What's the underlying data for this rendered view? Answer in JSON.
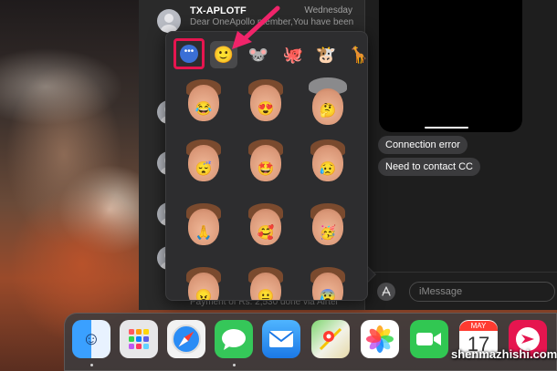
{
  "conversation_list": {
    "top_item": {
      "name": "TX-APLOTF",
      "date": "Wednesday",
      "preview": "Dear OneApollo member,You have been"
    },
    "bottom_preview": "Payment of Rs. 2,530 done via Airtel"
  },
  "chat": {
    "bubbles": [
      "Connection error",
      "Need to contact CC"
    ],
    "input_placeholder": "iMessage"
  },
  "sticker_popover": {
    "more_packs_label": "•••",
    "packs": [
      {
        "name": "memoji-pack",
        "glyph": "🙂"
      },
      {
        "name": "mouse-pack",
        "glyph": "🐭"
      },
      {
        "name": "octopus-pack",
        "glyph": "🐙"
      },
      {
        "name": "cow-pack",
        "glyph": "🐮"
      },
      {
        "name": "giraffe-pack",
        "glyph": "🦒"
      }
    ],
    "stickers": [
      {
        "name": "laughing-memoji",
        "face": "😂"
      },
      {
        "name": "heart-eyes-memoji",
        "face": "😍"
      },
      {
        "name": "thinking-hat-memoji",
        "face": "🤔"
      },
      {
        "name": "sleeping-memoji",
        "face": "😴"
      },
      {
        "name": "star-eyes-memoji",
        "face": "🤩"
      },
      {
        "name": "sad-sweat-memoji",
        "face": "😥"
      },
      {
        "name": "praying-memoji",
        "face": "🙏"
      },
      {
        "name": "hearts-memoji",
        "face": "🥰"
      },
      {
        "name": "party-memoji",
        "face": "🥳"
      },
      {
        "name": "angry-memoji",
        "face": "😠"
      },
      {
        "name": "neutral-memoji",
        "face": "😐"
      },
      {
        "name": "cold-sweat-memoji",
        "face": "😰"
      }
    ]
  },
  "dock": {
    "apps": [
      {
        "name": "finder",
        "glyph": "☺"
      },
      {
        "name": "launchpad",
        "glyph": "▦"
      },
      {
        "name": "safari",
        "glyph": "🧭"
      },
      {
        "name": "messages",
        "glyph": "💬"
      },
      {
        "name": "mail",
        "glyph": "✉"
      },
      {
        "name": "maps",
        "glyph": "📍"
      },
      {
        "name": "photos",
        "glyph": "🌸"
      },
      {
        "name": "facetime",
        "glyph": "📹"
      },
      {
        "name": "calendar",
        "month": "MAY",
        "day": "17"
      },
      {
        "name": "skitch",
        "glyph": "➤"
      }
    ]
  },
  "colors": {
    "highlight": "#e6154f",
    "bubble_gray": "#3b3b3d",
    "pointer_arrow": "#f0246a"
  },
  "watermark": "shenmazhishi.com"
}
